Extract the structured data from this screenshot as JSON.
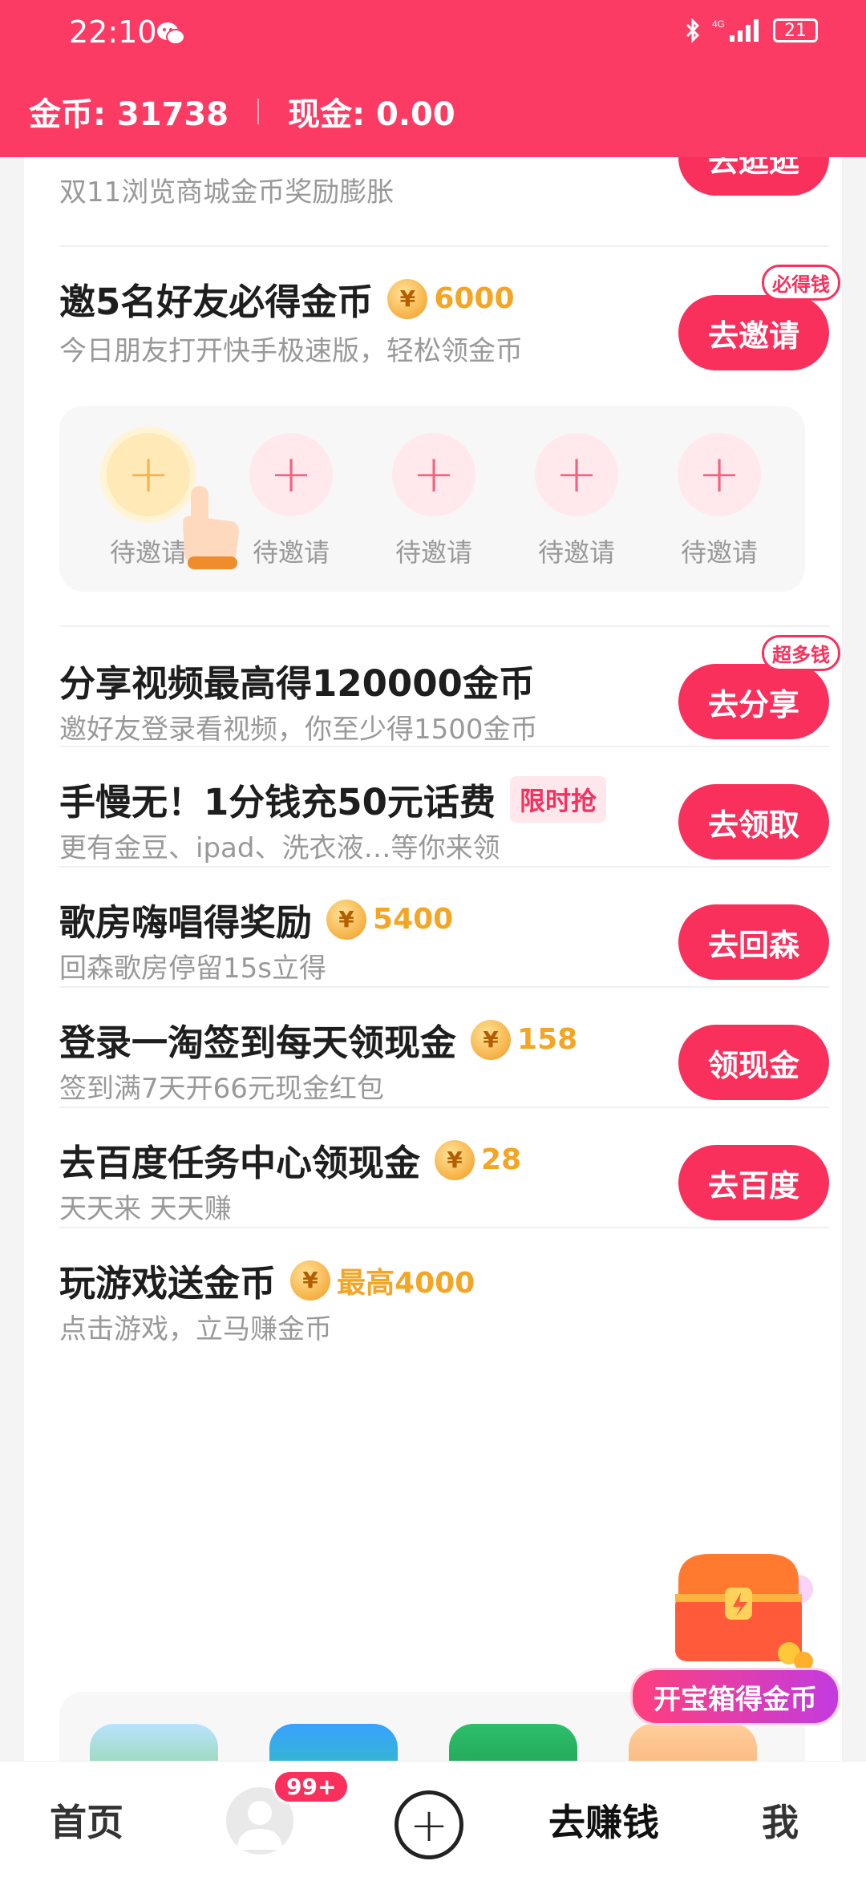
{
  "status_bar": {
    "time": "22:10",
    "battery": "21"
  },
  "header": {
    "coins": "金币: 31738",
    "cash": "现金: 0.00"
  },
  "tasks": [
    {
      "title": "",
      "subtitle": "双11浏览商城金币奖励膨胀",
      "button": "去逛逛"
    },
    {
      "title": "邀5名好友必得金币",
      "reward": "6000",
      "subtitle": "今日朋友打开快手极速版，轻松领金币",
      "button": "去邀请",
      "tag": "必得钱"
    },
    {
      "title": "分享视频最高得120000金币",
      "subtitle": "邀好友登录看视频，你至少得1500金币",
      "button": "去分享",
      "tag": "超多钱"
    },
    {
      "title": "手慢无！1分钱充50元话费",
      "badge": "限时抢",
      "subtitle": "更有金豆、ipad、洗衣液…等你来领",
      "button": "去领取"
    },
    {
      "title": "歌房嗨唱得奖励",
      "reward": "5400",
      "subtitle": "回森歌房停留15s立得",
      "button": "去回森"
    },
    {
      "title": "登录一淘签到每天领现金",
      "reward": "158",
      "subtitle": "签到满7天开66元现金红包",
      "button": "领现金"
    },
    {
      "title": "去百度任务中心领现金",
      "reward": "28",
      "subtitle": "天天来 天天赚",
      "button": "去百度"
    },
    {
      "title": "玩游戏送金币",
      "reward": "最高4000",
      "subtitle": "点击游戏，立马赚金币"
    }
  ],
  "invite_slots": [
    "待邀请",
    "待邀请",
    "待邀请",
    "待邀请",
    "待邀请"
  ],
  "invite_slot_symbol": "+",
  "coin_symbol": "¥",
  "treasure": {
    "label": "开宝箱得金币"
  },
  "bottom_nav": {
    "home": "首页",
    "badge": "99+",
    "plus": "+",
    "earn": "去赚钱",
    "me": "我"
  },
  "colors": {
    "brand": "#fb3b63",
    "button": "#f9305c",
    "reward": "#f5a524"
  }
}
